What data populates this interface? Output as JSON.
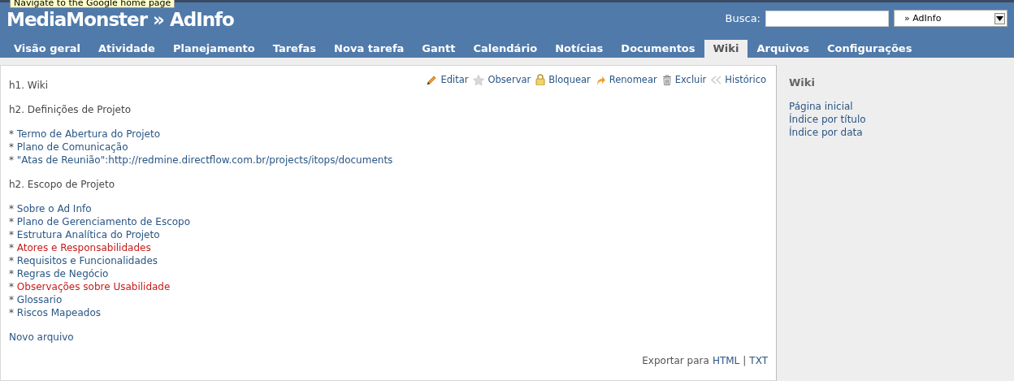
{
  "tooltip": "Navigate to the Google home page",
  "header": {
    "title": "MediaMonster » AdInfo",
    "search_label": "Busca:",
    "project_select": "» AdInfo"
  },
  "tabs": [
    {
      "label": "Visão geral",
      "selected": false
    },
    {
      "label": "Atividade",
      "selected": false
    },
    {
      "label": "Planejamento",
      "selected": false
    },
    {
      "label": "Tarefas",
      "selected": false
    },
    {
      "label": "Nova tarefa",
      "selected": false
    },
    {
      "label": "Gantt",
      "selected": false
    },
    {
      "label": "Calendário",
      "selected": false
    },
    {
      "label": "Notícias",
      "selected": false
    },
    {
      "label": "Documentos",
      "selected": false
    },
    {
      "label": "Wiki",
      "selected": true
    },
    {
      "label": "Arquivos",
      "selected": false
    },
    {
      "label": "Configurações",
      "selected": false
    }
  ],
  "actions": [
    {
      "kind": "pencil",
      "label": "Editar"
    },
    {
      "kind": "star",
      "label": "Observar"
    },
    {
      "kind": "lock",
      "label": "Bloquear"
    },
    {
      "kind": "arrow",
      "label": "Renomear"
    },
    {
      "kind": "trash",
      "label": "Excluir"
    },
    {
      "kind": "history",
      "label": "Histórico"
    }
  ],
  "blocks": [
    {
      "lines": [
        {
          "kind": "text",
          "text": "h1. Wiki"
        }
      ]
    },
    {
      "lines": [
        {
          "kind": "text",
          "text": "h2. Definições de Projeto"
        }
      ]
    },
    {
      "lines": [
        {
          "kind": "bullet",
          "marker": "*",
          "label": "Termo de Abertura do Projeto",
          "missing": false
        },
        {
          "kind": "bullet",
          "marker": "*",
          "label": "Plano de Comunicação",
          "missing": false
        },
        {
          "kind": "bullet",
          "marker": "*",
          "label": "\"Atas de Reunião\":http://redmine.directflow.com.br/projects/itops/documents",
          "missing": false
        }
      ]
    },
    {
      "lines": [
        {
          "kind": "text",
          "text": "h2. Escopo de Projeto"
        }
      ]
    },
    {
      "lines": [
        {
          "kind": "bullet",
          "marker": "*",
          "label": "Sobre o Ad Info",
          "missing": false
        },
        {
          "kind": "bullet",
          "marker": "*",
          "label": "Plano de Gerenciamento de Escopo",
          "missing": false
        },
        {
          "kind": "bullet",
          "marker": "*",
          "label": "Estrutura Analítica do Projeto",
          "missing": false
        },
        {
          "kind": "bullet",
          "marker": "*",
          "label": "Atores e Responsabilidades",
          "missing": true
        },
        {
          "kind": "bullet",
          "marker": "*",
          "label": "Requisitos e Funcionalidades",
          "missing": false
        },
        {
          "kind": "bullet",
          "marker": "*",
          "label": "Regras de Negócio",
          "missing": false
        },
        {
          "kind": "bullet",
          "marker": "*",
          "label": "Observações sobre Usabilidade",
          "missing": true
        },
        {
          "kind": "bullet",
          "marker": "*",
          "label": "Glossario",
          "missing": false
        },
        {
          "kind": "bullet",
          "marker": "*",
          "label": "Riscos Mapeados",
          "missing": false
        }
      ]
    },
    {
      "lines": [
        {
          "kind": "link",
          "text": "Novo arquivo"
        }
      ]
    }
  ],
  "export": {
    "label": "Exportar para",
    "formats": [
      "HTML",
      "TXT"
    ],
    "separator": "|"
  },
  "sidebar": {
    "title": "Wiki",
    "items": [
      "Página inicial",
      "Índice por título",
      "Índice por data"
    ]
  }
}
